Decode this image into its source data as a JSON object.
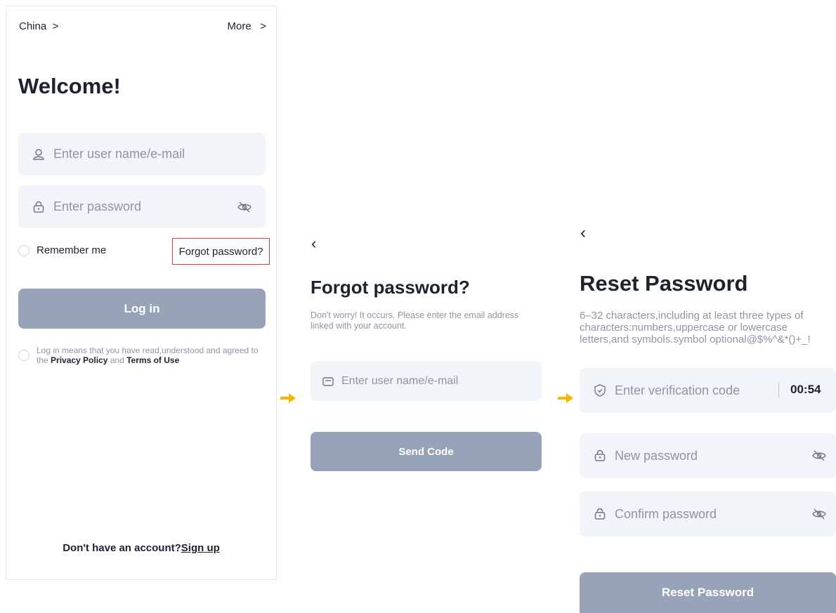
{
  "colors": {
    "accent_arrow": "#f5b800",
    "button_bg": "#97a4b8",
    "field_bg": "#f1f4f9",
    "highlight_border": "#e03a3a"
  },
  "login": {
    "region_label": "China",
    "more_label": "More",
    "chevron": ">",
    "heading": "Welcome!",
    "username_placeholder": "Enter user name/e-mail",
    "password_placeholder": "Enter password",
    "remember_label": "Remember me",
    "forgot_label": "Forgot password?",
    "login_button": "Log in",
    "terms_prefix": "Log in means that you have read,understood and agreed to the ",
    "privacy_link": "Privacy Policy",
    "terms_and": " and ",
    "terms_link": "Terms of Use",
    "signup_prompt": "Don't have an account?",
    "signup_link": "Sign up"
  },
  "forgot": {
    "back": "‹",
    "heading": "Forgot password?",
    "description": "Don't worry! It occurs. Please enter the email address linked with your account.",
    "email_placeholder": "Enter user name/e-mail",
    "send_button": "Send Code"
  },
  "reset": {
    "back": "‹",
    "heading": "Reset Password",
    "description": "6–32 characters,including at least three types of characters:numbers,uppercase or lowercase letters,and symbols.symbol optional@$%^&*()+_!",
    "code_placeholder": "Enter verification code",
    "timer": "00:54",
    "new_password_placeholder": "New password",
    "confirm_password_placeholder": "Confirm password",
    "reset_button": "Reset Password"
  }
}
